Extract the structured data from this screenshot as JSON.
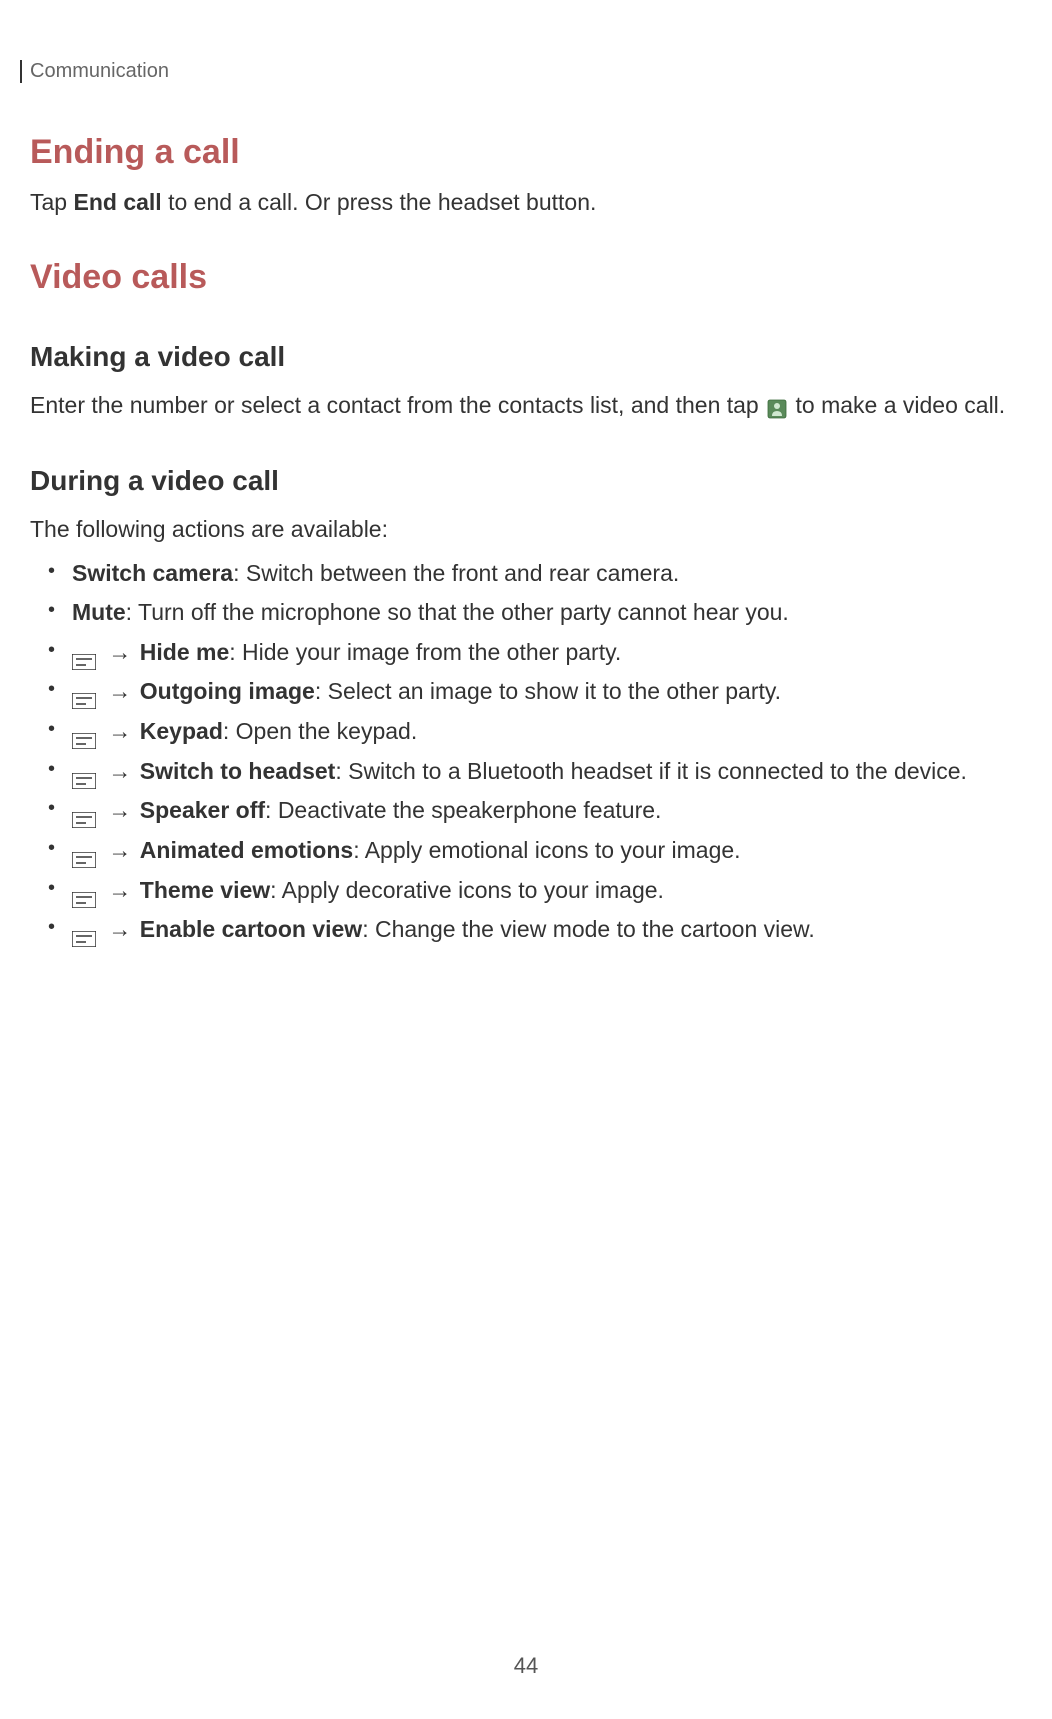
{
  "header": "Communication",
  "section1": {
    "title": "Ending a call",
    "text_before_bold": "Tap ",
    "text_bold": "End call",
    "text_after_bold": " to end a call. Or press the headset button."
  },
  "section2": {
    "title": "Video calls",
    "sub1": {
      "title": "Making a video call",
      "text_before_icon": "Enter the number or select a contact from the contacts list, and then tap ",
      "text_after_icon": " to make a video call."
    },
    "sub2": {
      "title": "During a video call",
      "intro": "The following actions are available:",
      "items": [
        {
          "has_menu_icon": false,
          "bold": "Switch camera",
          "rest": ": Switch between the front and rear camera."
        },
        {
          "has_menu_icon": false,
          "bold": "Mute",
          "rest": ": Turn off the microphone so that the other party cannot hear you."
        },
        {
          "has_menu_icon": true,
          "arrow": " → ",
          "bold": "Hide me",
          "rest": ": Hide your image from the other party."
        },
        {
          "has_menu_icon": true,
          "arrow": " → ",
          "bold": "Outgoing image",
          "rest": ": Select an image to show it to the other party."
        },
        {
          "has_menu_icon": true,
          "arrow": " → ",
          "bold": "Keypad",
          "rest": ": Open the keypad."
        },
        {
          "has_menu_icon": true,
          "arrow": " → ",
          "bold": "Switch to headset",
          "rest": ": Switch to a Bluetooth headset if it is connected to the device."
        },
        {
          "has_menu_icon": true,
          "arrow": " → ",
          "bold": "Speaker off",
          "rest": ": Deactivate the speakerphone feature."
        },
        {
          "has_menu_icon": true,
          "arrow": " → ",
          "bold": "Animated emotions",
          "rest": ": Apply emotional icons to your image."
        },
        {
          "has_menu_icon": true,
          "arrow": " → ",
          "bold": "Theme view",
          "rest": ": Apply decorative icons to your image."
        },
        {
          "has_menu_icon": true,
          "arrow": " → ",
          "bold": "Enable cartoon view",
          "rest": ": Change the view mode to the cartoon view."
        }
      ]
    }
  },
  "page_number": "44"
}
